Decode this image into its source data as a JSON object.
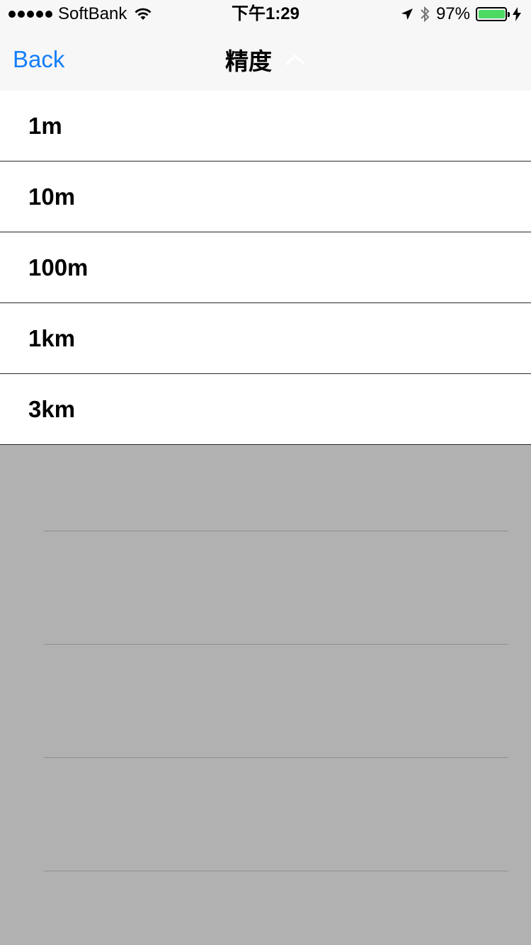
{
  "status_bar": {
    "carrier": "SoftBank",
    "time": "下午1:29",
    "battery_percent": "97%",
    "battery_level": 0.97,
    "icons": [
      "signal-dots-icon",
      "wifi-icon",
      "location-arrow-icon",
      "bluetooth-icon",
      "battery-icon",
      "charging-bolt-icon"
    ]
  },
  "nav": {
    "back_label": "Back",
    "title": "精度",
    "title_icon": "chevron-up-icon"
  },
  "list": {
    "items": [
      {
        "label": "1m"
      },
      {
        "label": "10m"
      },
      {
        "label": "100m"
      },
      {
        "label": "1km"
      },
      {
        "label": "3km"
      }
    ]
  },
  "colors": {
    "accent": "#147efb",
    "nav_background": "#f7f7f7",
    "dim_overlay": "#b1b1b1",
    "battery": "#4cd964"
  }
}
